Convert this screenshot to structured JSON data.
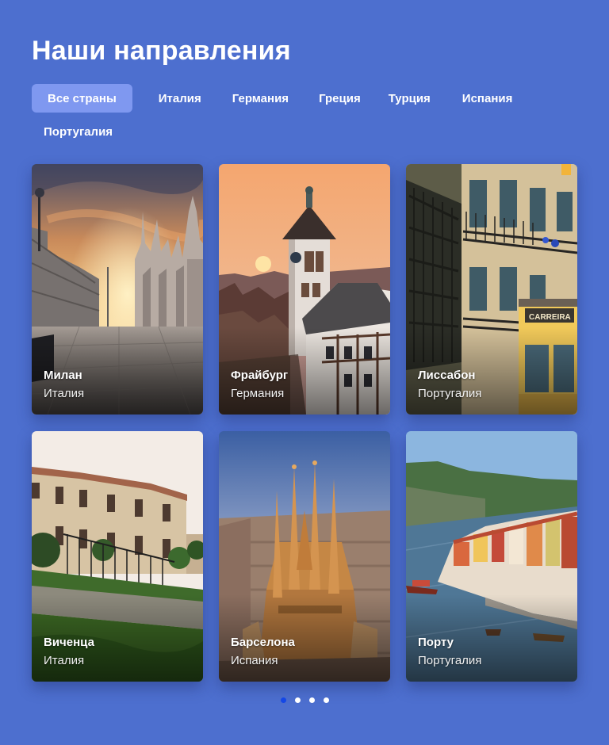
{
  "header": {
    "title": "Наши направления"
  },
  "filters": [
    {
      "label": "Все страны",
      "active": true
    },
    {
      "label": "Италия"
    },
    {
      "label": "Германия"
    },
    {
      "label": "Греция"
    },
    {
      "label": "Турция"
    },
    {
      "label": "Испания"
    },
    {
      "label": "Португалия"
    }
  ],
  "destinations": [
    {
      "city": "Милан",
      "country": "Италия"
    },
    {
      "city": "Фрайбург",
      "country": "Германия"
    },
    {
      "city": "Лиссабон",
      "country": "Португалия",
      "tram_sign": "CARREIRA"
    },
    {
      "city": "Виченца",
      "country": "Италия"
    },
    {
      "city": "Барселона",
      "country": "Испания"
    },
    {
      "city": "Порту",
      "country": "Португалия"
    }
  ],
  "pagination": {
    "pages": 4,
    "current": 1
  },
  "colors": {
    "background": "#4d6fcf",
    "active_chip": "#7f98f0",
    "active_dot": "#1447e6"
  }
}
